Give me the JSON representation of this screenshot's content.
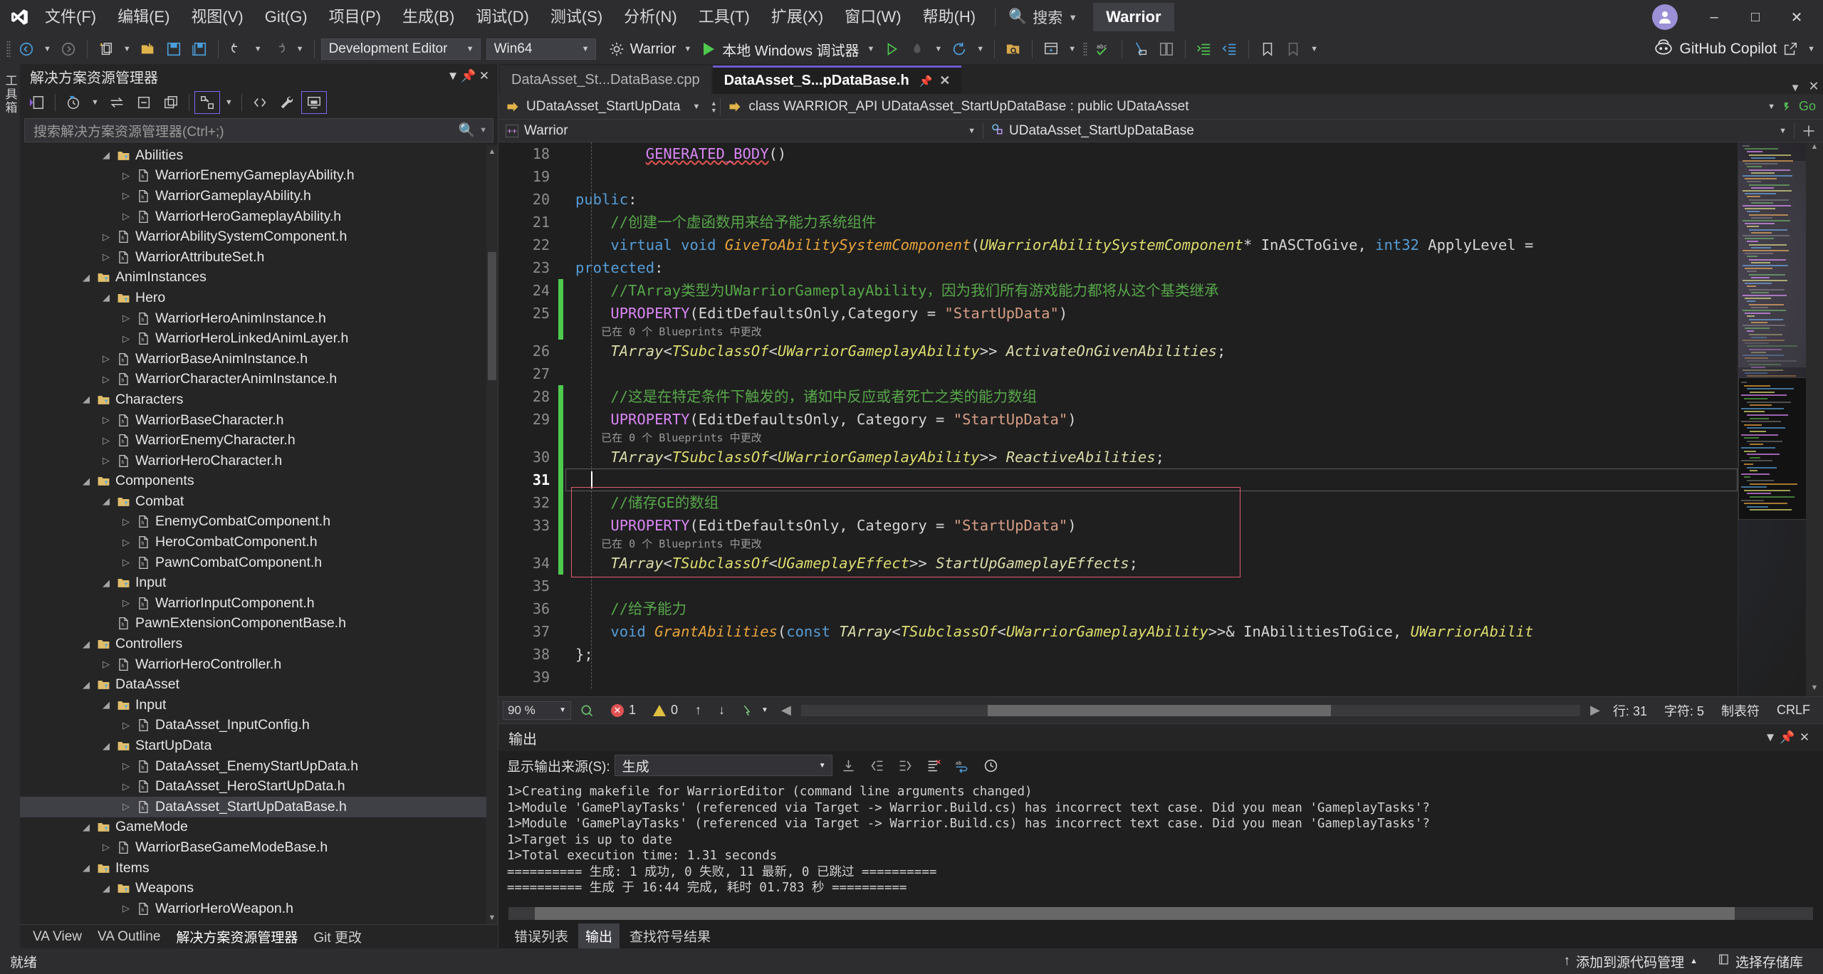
{
  "titlebar": {
    "menus": [
      "文件(F)",
      "编辑(E)",
      "视图(V)",
      "Git(G)",
      "项目(P)",
      "生成(B)",
      "调试(D)",
      "测试(S)",
      "分析(N)",
      "工具(T)",
      "扩展(X)",
      "窗口(W)",
      "帮助(H)"
    ],
    "search_placeholder": "搜索",
    "solution_name": "Warrior",
    "minimize": "–",
    "maximize": "□",
    "close": "✕"
  },
  "toolbar": {
    "config": "Development Editor",
    "platform": "Win64",
    "project": "Warrior",
    "debugger": "本地 Windows 调试器",
    "copilot": "GitHub Copilot"
  },
  "left_rail": {
    "label": "工具箱"
  },
  "solution_explorer": {
    "title": "解决方案资源管理器",
    "search_placeholder": "搜索解决方案资源管理器(Ctrl+;)",
    "tabs": [
      "VA View",
      "VA Outline",
      "解决方案资源管理器",
      "Git 更改"
    ],
    "active_tab": "解决方案资源管理器",
    "tree": [
      {
        "label": "Abilities",
        "type": "folder",
        "depth": 3,
        "twist": "down"
      },
      {
        "label": "WarriorEnemyGameplayAbility.h",
        "type": "file",
        "depth": 4,
        "twist": "right"
      },
      {
        "label": "WarriorGameplayAbility.h",
        "type": "file",
        "depth": 4,
        "twist": "right"
      },
      {
        "label": "WarriorHeroGameplayAbility.h",
        "type": "file",
        "depth": 4,
        "twist": "right"
      },
      {
        "label": "WarriorAbilitySystemComponent.h",
        "type": "file",
        "depth": 3,
        "twist": "right"
      },
      {
        "label": "WarriorAttributeSet.h",
        "type": "file",
        "depth": 3,
        "twist": "right"
      },
      {
        "label": "AnimInstances",
        "type": "folder",
        "depth": 2,
        "twist": "down"
      },
      {
        "label": "Hero",
        "type": "folder",
        "depth": 3,
        "twist": "down"
      },
      {
        "label": "WarriorHeroAnimInstance.h",
        "type": "file",
        "depth": 4,
        "twist": "right"
      },
      {
        "label": "WarriorHeroLinkedAnimLayer.h",
        "type": "file",
        "depth": 4,
        "twist": "right"
      },
      {
        "label": "WarriorBaseAnimInstance.h",
        "type": "file",
        "depth": 3,
        "twist": "right"
      },
      {
        "label": "WarriorCharacterAnimInstance.h",
        "type": "file",
        "depth": 3,
        "twist": "right"
      },
      {
        "label": "Characters",
        "type": "folder",
        "depth": 2,
        "twist": "down"
      },
      {
        "label": "WarriorBaseCharacter.h",
        "type": "file",
        "depth": 3,
        "twist": "right"
      },
      {
        "label": "WarriorEnemyCharacter.h",
        "type": "file",
        "depth": 3,
        "twist": "right"
      },
      {
        "label": "WarriorHeroCharacter.h",
        "type": "file",
        "depth": 3,
        "twist": "right"
      },
      {
        "label": "Components",
        "type": "folder",
        "depth": 2,
        "twist": "down"
      },
      {
        "label": "Combat",
        "type": "folder",
        "depth": 3,
        "twist": "down"
      },
      {
        "label": "EnemyCombatComponent.h",
        "type": "file",
        "depth": 4,
        "twist": "right"
      },
      {
        "label": "HeroCombatComponent.h",
        "type": "file",
        "depth": 4,
        "twist": "right"
      },
      {
        "label": "PawnCombatComponent.h",
        "type": "file",
        "depth": 4,
        "twist": "right"
      },
      {
        "label": "Input",
        "type": "folder",
        "depth": 3,
        "twist": "down"
      },
      {
        "label": "WarriorInputComponent.h",
        "type": "file",
        "depth": 4,
        "twist": "right"
      },
      {
        "label": "PawnExtensionComponentBase.h",
        "type": "file",
        "depth": 3,
        "twist": "none"
      },
      {
        "label": "Controllers",
        "type": "folder",
        "depth": 2,
        "twist": "down"
      },
      {
        "label": "WarriorHeroController.h",
        "type": "file",
        "depth": 3,
        "twist": "right"
      },
      {
        "label": "DataAsset",
        "type": "folder",
        "depth": 2,
        "twist": "down"
      },
      {
        "label": "Input",
        "type": "folder",
        "depth": 3,
        "twist": "down"
      },
      {
        "label": "DataAsset_InputConfig.h",
        "type": "file",
        "depth": 4,
        "twist": "right"
      },
      {
        "label": "StartUpData",
        "type": "folder",
        "depth": 3,
        "twist": "down"
      },
      {
        "label": "DataAsset_EnemyStartUpData.h",
        "type": "file",
        "depth": 4,
        "twist": "right"
      },
      {
        "label": "DataAsset_HeroStartUpData.h",
        "type": "file",
        "depth": 4,
        "twist": "right"
      },
      {
        "label": "DataAsset_StartUpDataBase.h",
        "type": "file",
        "depth": 4,
        "twist": "right",
        "selected": true
      },
      {
        "label": "GameMode",
        "type": "folder",
        "depth": 2,
        "twist": "down"
      },
      {
        "label": "WarriorBaseGameModeBase.h",
        "type": "file",
        "depth": 3,
        "twist": "right"
      },
      {
        "label": "Items",
        "type": "folder",
        "depth": 2,
        "twist": "down"
      },
      {
        "label": "Weapons",
        "type": "folder",
        "depth": 3,
        "twist": "down"
      },
      {
        "label": "WarriorHeroWeapon.h",
        "type": "file",
        "depth": 4,
        "twist": "right"
      }
    ]
  },
  "editor": {
    "tabs": [
      {
        "label": "DataAsset_St...DataBase.cpp",
        "active": false
      },
      {
        "label": "DataAsset_S...pDataBase.h",
        "active": true
      }
    ],
    "nav_left": "UDataAsset_StartUpData",
    "nav_right": "class WARRIOR_API UDataAsset_StartUpDataBase : public UDataAsset",
    "go_label": "Go",
    "scope_left": "Warrior",
    "scope_right": "UDataAsset_StartUpDataBase",
    "zoom": "90 %",
    "error_count": "1",
    "warning_count": "0",
    "caret_line": "行: 31",
    "caret_col": "字符: 5",
    "tabs_mode": "制表符",
    "line_ending": "CRLF",
    "lines": [
      {
        "num": "18",
        "kind": "code",
        "tokens": [
          {
            "t": "        ",
            "c": "pl"
          },
          {
            "t": "GENERATED_BODY",
            "c": "mac squig"
          },
          {
            "t": "()",
            "c": "pl"
          }
        ]
      },
      {
        "num": "19",
        "kind": "code",
        "tokens": []
      },
      {
        "num": "20",
        "kind": "code",
        "tokens": [
          {
            "t": "public",
            "c": "kw"
          },
          {
            "t": ":",
            "c": "pl"
          }
        ]
      },
      {
        "num": "21",
        "kind": "code",
        "tokens": [
          {
            "t": "    //创建一个虚函数用来给予能力系统组件",
            "c": "cm"
          }
        ]
      },
      {
        "num": "22",
        "kind": "code",
        "tokens": [
          {
            "t": "    ",
            "c": "pl"
          },
          {
            "t": "virtual",
            "c": "kw"
          },
          {
            "t": " ",
            "c": "pl"
          },
          {
            "t": "void",
            "c": "kw"
          },
          {
            "t": " ",
            "c": "pl"
          },
          {
            "t": "GiveToAbilitySystemComponent",
            "c": "fn"
          },
          {
            "t": "(",
            "c": "pl"
          },
          {
            "t": "UWarriorAbilitySystemComponent",
            "c": "typ"
          },
          {
            "t": "* InASCToGive, ",
            "c": "pl"
          },
          {
            "t": "int32",
            "c": "kw"
          },
          {
            "t": " ApplyLevel =",
            "c": "pl"
          }
        ]
      },
      {
        "num": "23",
        "kind": "code",
        "tokens": [
          {
            "t": "protected",
            "c": "kw"
          },
          {
            "t": ":",
            "c": "pl"
          }
        ]
      },
      {
        "num": "24",
        "kind": "code",
        "tokens": [
          {
            "t": "    //TArray类型为UWarriorGameplayAbility，因为我们所有游戏能力都将从这个基类继承",
            "c": "cm"
          }
        ]
      },
      {
        "num": "25",
        "kind": "code",
        "tokens": [
          {
            "t": "    ",
            "c": "pl"
          },
          {
            "t": "UPROPERTY",
            "c": "mac"
          },
          {
            "t": "(EditDefaultsOnly,Category = ",
            "c": "pl"
          },
          {
            "t": "\"StartUpData\"",
            "c": "str"
          },
          {
            "t": ")",
            "c": "pl"
          }
        ]
      },
      {
        "num": "",
        "kind": "hint",
        "text": "    已在 0 个 Blueprints 中更改"
      },
      {
        "num": "26",
        "kind": "code",
        "tokens": [
          {
            "t": "    ",
            "c": "pl"
          },
          {
            "t": "TArray",
            "c": "var"
          },
          {
            "t": "<",
            "c": "pl"
          },
          {
            "t": "TSubclassOf",
            "c": "typ"
          },
          {
            "t": "<",
            "c": "pl"
          },
          {
            "t": "UWarriorGameplayAbility",
            "c": "typ"
          },
          {
            "t": ">> ",
            "c": "pl"
          },
          {
            "t": "ActivateOnGivenAbilities",
            "c": "var"
          },
          {
            "t": ";",
            "c": "pl"
          }
        ]
      },
      {
        "num": "27",
        "kind": "code",
        "tokens": []
      },
      {
        "num": "28",
        "kind": "code",
        "tokens": [
          {
            "t": "    //这是在特定条件下触发的，诸如中反应或者死亡之类的能力数组",
            "c": "cm"
          }
        ]
      },
      {
        "num": "29",
        "kind": "code",
        "tokens": [
          {
            "t": "    ",
            "c": "pl"
          },
          {
            "t": "UPROPERTY",
            "c": "mac"
          },
          {
            "t": "(EditDefaultsOnly, Category = ",
            "c": "pl"
          },
          {
            "t": "\"StartUpData\"",
            "c": "str"
          },
          {
            "t": ")",
            "c": "pl"
          }
        ]
      },
      {
        "num": "",
        "kind": "hint",
        "text": "    已在 0 个 Blueprints 中更改"
      },
      {
        "num": "30",
        "kind": "code",
        "tokens": [
          {
            "t": "    ",
            "c": "pl"
          },
          {
            "t": "TArray",
            "c": "var"
          },
          {
            "t": "<",
            "c": "pl"
          },
          {
            "t": "TSubclassOf",
            "c": "typ"
          },
          {
            "t": "<",
            "c": "pl"
          },
          {
            "t": "UWarriorGameplayAbility",
            "c": "typ"
          },
          {
            "t": ">> ",
            "c": "pl"
          },
          {
            "t": "ReactiveAbilities",
            "c": "var"
          },
          {
            "t": ";",
            "c": "pl"
          }
        ]
      },
      {
        "num": "31",
        "kind": "current",
        "tokens": []
      },
      {
        "num": "32",
        "kind": "code",
        "tokens": [
          {
            "t": "    //储存GE的数组",
            "c": "cm"
          }
        ]
      },
      {
        "num": "33",
        "kind": "code",
        "tokens": [
          {
            "t": "    ",
            "c": "pl"
          },
          {
            "t": "UPROPERTY",
            "c": "mac"
          },
          {
            "t": "(EditDefaultsOnly, Category = ",
            "c": "pl"
          },
          {
            "t": "\"StartUpData\"",
            "c": "str"
          },
          {
            "t": ")",
            "c": "pl"
          }
        ]
      },
      {
        "num": "",
        "kind": "hint",
        "text": "    已在 0 个 Blueprints 中更改"
      },
      {
        "num": "34",
        "kind": "code",
        "tokens": [
          {
            "t": "    ",
            "c": "pl"
          },
          {
            "t": "TArray",
            "c": "var"
          },
          {
            "t": "<",
            "c": "pl"
          },
          {
            "t": "TSubclassOf",
            "c": "typ"
          },
          {
            "t": "<",
            "c": "pl"
          },
          {
            "t": "UGameplayEffect",
            "c": "typ"
          },
          {
            "t": ">> ",
            "c": "pl"
          },
          {
            "t": "StartUpGameplayEffects",
            "c": "var"
          },
          {
            "t": ";",
            "c": "pl"
          }
        ]
      },
      {
        "num": "35",
        "kind": "code",
        "tokens": []
      },
      {
        "num": "36",
        "kind": "code",
        "tokens": [
          {
            "t": "    //给予能力",
            "c": "cm"
          }
        ]
      },
      {
        "num": "37",
        "kind": "code",
        "tokens": [
          {
            "t": "    ",
            "c": "pl"
          },
          {
            "t": "void",
            "c": "kw"
          },
          {
            "t": " ",
            "c": "pl"
          },
          {
            "t": "GrantAbilities",
            "c": "fn"
          },
          {
            "t": "(",
            "c": "pl"
          },
          {
            "t": "const",
            "c": "kw"
          },
          {
            "t": " ",
            "c": "pl"
          },
          {
            "t": "TArray",
            "c": "var"
          },
          {
            "t": "<",
            "c": "pl"
          },
          {
            "t": "TSubclassOf",
            "c": "typ"
          },
          {
            "t": "<",
            "c": "pl"
          },
          {
            "t": "UWarriorGameplayAbility",
            "c": "typ"
          },
          {
            "t": ">>& InAbilitiesToGice, ",
            "c": "pl"
          },
          {
            "t": "UWarriorAbilit",
            "c": "typ"
          }
        ]
      },
      {
        "num": "38",
        "kind": "code",
        "tokens": [
          {
            "t": "};",
            "c": "pl"
          }
        ]
      },
      {
        "num": "39",
        "kind": "code",
        "tokens": []
      }
    ]
  },
  "output": {
    "title": "输出",
    "source_label": "显示输出来源(S):",
    "source_value": "生成",
    "tabs": [
      "错误列表",
      "输出",
      "查找符号结果"
    ],
    "active_tab": "输出",
    "lines": [
      "1>Creating makefile for WarriorEditor (command line arguments changed)",
      "1>Module 'GamePlayTasks' (referenced via Target -> Warrior.Build.cs) has incorrect text case. Did you mean 'GameplayTasks'?",
      "1>Module 'GamePlayTasks' (referenced via Target -> Warrior.Build.cs) has incorrect text case. Did you mean 'GameplayTasks'?",
      "1>Target is up to date",
      "1>Total execution time: 1.31 seconds",
      "========== 生成: 1 成功, 0 失败, 11 最新, 0 已跳过 ==========",
      "========== 生成 于 16:44 完成, 耗时 01.783 秒 =========="
    ]
  },
  "statusbar": {
    "state": "就绪",
    "source_control": "添加到源代码管理",
    "repo": "选择存储库"
  },
  "colors": {
    "accent": "#6a5acd",
    "error": "#e05252",
    "warning": "#e0c040",
    "ok": "#4ec94e",
    "redbox": "#e05b6f",
    "changebar": "#4ec94e"
  }
}
